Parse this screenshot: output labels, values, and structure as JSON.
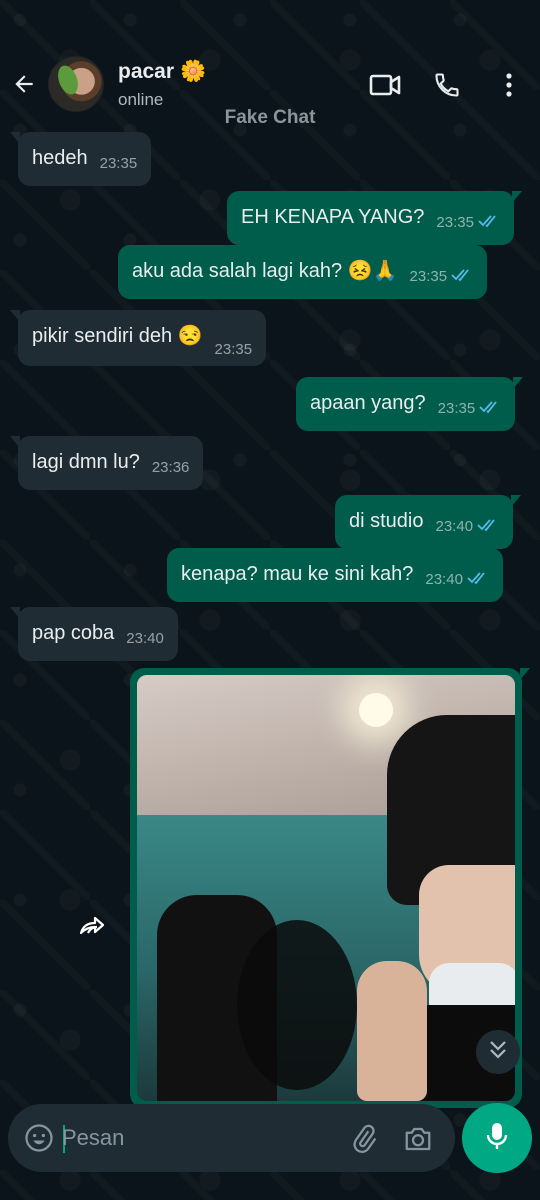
{
  "header": {
    "name": "pacar",
    "name_emoji": "🌼",
    "status": "online",
    "watermark": "Fake Chat"
  },
  "messages": [
    {
      "dir": "in",
      "text": "hedeh",
      "time": "23:35"
    },
    {
      "dir": "out",
      "text": "EH KENAPA YANG?",
      "time": "23:35",
      "read": true
    },
    {
      "dir": "out",
      "text": "aku ada salah lagi kah? 😣🙏",
      "time": "23:35",
      "read": true
    },
    {
      "dir": "in",
      "text": "pikir sendiri deh 😒",
      "time": "23:35"
    },
    {
      "dir": "out",
      "text": "apaan yang?",
      "time": "23:35",
      "read": true
    },
    {
      "dir": "in",
      "text": "lagi dmn lu?",
      "time": "23:36"
    },
    {
      "dir": "out",
      "text": "di studio",
      "time": "23:40",
      "read": true
    },
    {
      "dir": "out",
      "text": "kenapa? mau ke sini kah?",
      "time": "23:40",
      "read": true
    },
    {
      "dir": "in",
      "text": "pap coba",
      "time": "23:40"
    }
  ],
  "composer": {
    "placeholder": "Pesan"
  },
  "colors": {
    "background": "#0b141a",
    "incoming": "#202c33",
    "outgoing": "#005c4b",
    "accent": "#00a884",
    "read_ticks": "#53bdeb"
  },
  "icons": {
    "back": "arrow-left-icon",
    "video": "video-call-icon",
    "call": "phone-icon",
    "menu": "more-vertical-icon",
    "forward": "forward-icon",
    "scroll": "double-chevron-down-icon",
    "emoji": "emoji-icon",
    "attach": "paperclip-icon",
    "camera": "camera-icon",
    "mic": "mic-icon"
  }
}
